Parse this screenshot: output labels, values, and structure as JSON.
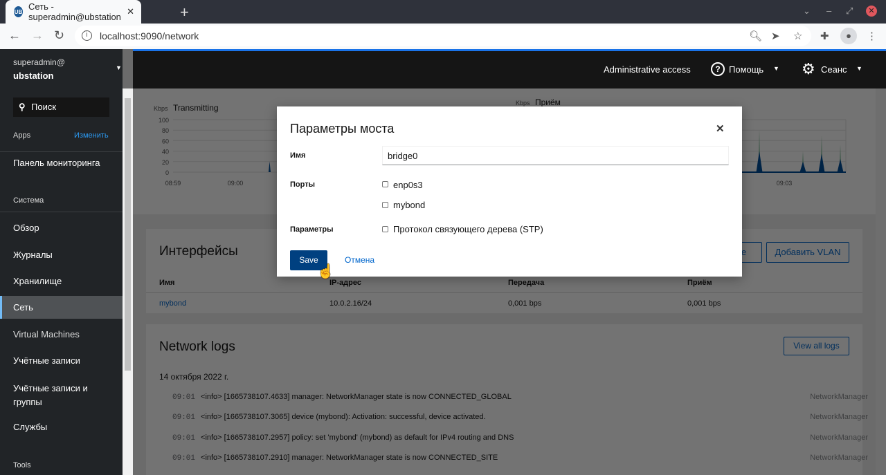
{
  "browser": {
    "tab_title": "Сеть - superadmin@ubstation",
    "favicon": "UB",
    "url": "localhost:9090/network"
  },
  "sidebar": {
    "user": "superadmin@",
    "host": "ubstation",
    "search_placeholder": "Поиск",
    "apps_label": "Apps",
    "edit_label": "Изменить",
    "apps": [
      {
        "label": "Панель мониторинга"
      }
    ],
    "system_label": "Система",
    "items": [
      {
        "label": "Обзор"
      },
      {
        "label": "Журналы"
      },
      {
        "label": "Хранилище"
      },
      {
        "label": "Сеть",
        "active": true
      },
      {
        "label": "Virtual Machines"
      },
      {
        "label": "Учётные записи"
      },
      {
        "label": "Учётные записи и группы"
      },
      {
        "label": "Службы"
      }
    ],
    "tools_label": "Tools"
  },
  "header": {
    "admin": "Administrative access",
    "help": "Помощь",
    "session": "Сеанс"
  },
  "chart_data": [
    {
      "type": "area",
      "title": "Transmitting",
      "ylabel": "Kbps",
      "ylim": [
        0,
        100
      ],
      "yticks": [
        "100",
        "80",
        "60",
        "40",
        "20",
        "0"
      ],
      "xticks": [
        "08:59",
        "09:00"
      ],
      "series": [
        {
          "color": "#004b95",
          "points": [
            [
              "08:59",
              0
            ],
            [
              "09:00.5",
              0
            ],
            [
              "09:00.55",
              20
            ],
            [
              "09:00.6",
              0
            ],
            [
              "09:04",
              0
            ]
          ]
        }
      ]
    },
    {
      "type": "area",
      "title": "Приём",
      "ylabel": "Kbps",
      "ylim": [
        0,
        100
      ],
      "xticks": [
        "09:03"
      ],
      "series": [
        {
          "color": "#004b95",
          "points": [
            [
              "08:59",
              0
            ],
            [
              "09:02.55",
              0
            ],
            [
              "09:02.6",
              40
            ],
            [
              "09:02.65",
              0
            ],
            [
              "09:03.25",
              0
            ],
            [
              "09:03.3",
              20
            ],
            [
              "09:03.35",
              0
            ],
            [
              "09:03.55",
              0
            ],
            [
              "09:03.6",
              35
            ],
            [
              "09:03.65",
              0
            ],
            [
              "09:03.85",
              0
            ],
            [
              "09:03.9",
              25
            ],
            [
              "09:03.95",
              0
            ],
            [
              "09:04",
              0
            ]
          ]
        },
        {
          "color": "#8bc1a0",
          "points": [
            [
              "09:02.6",
              80
            ],
            [
              "09:03.3",
              40
            ],
            [
              "09:03.6",
              70
            ],
            [
              "09:03.9",
              52
            ]
          ]
        }
      ]
    }
  ],
  "interfaces": {
    "title": "Интерфейсы",
    "add_bridge": "Добавить bridge",
    "add_vlan": "Добавить VLAN",
    "columns": [
      "Имя",
      "IP-адрес",
      "Передача",
      "Приём"
    ],
    "rows": [
      {
        "name": "mybond",
        "ip": "10.0.2.16/24",
        "tx": "0,001 bps",
        "rx": "0,001 bps"
      }
    ]
  },
  "logs": {
    "title": "Network logs",
    "view_all": "View all logs",
    "date": "14 октября 2022 г.",
    "entries": [
      {
        "time": "09:01",
        "msg": "<info> [1665738107.4633] manager: NetworkManager state is now CONNECTED_GLOBAL",
        "src": "NetworkManager"
      },
      {
        "time": "09:01",
        "msg": "<info> [1665738107.3065] device (mybond): Activation: successful, device activated.",
        "src": "NetworkManager"
      },
      {
        "time": "09:01",
        "msg": "<info> [1665738107.2957] policy: set 'mybond' (mybond) as default for IPv4 routing and DNS",
        "src": "NetworkManager"
      },
      {
        "time": "09:01",
        "msg": "<info> [1665738107.2910] manager: NetworkManager state is now CONNECTED_SITE",
        "src": "NetworkManager"
      }
    ]
  },
  "modal": {
    "title": "Параметры моста",
    "name_label": "Имя",
    "name_value": "bridge0",
    "ports_label": "Порты",
    "ports": [
      {
        "label": "enp0s3",
        "checked": false
      },
      {
        "label": "mybond",
        "checked": false
      }
    ],
    "params_label": "Параметры",
    "stp_label": "Протокол связующего дерева (STP)",
    "save": "Save",
    "cancel": "Отмена"
  }
}
